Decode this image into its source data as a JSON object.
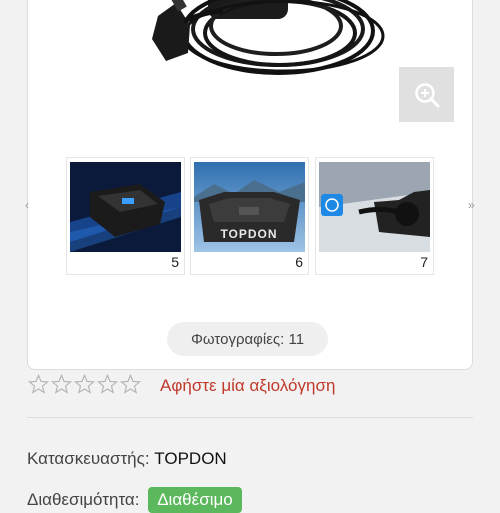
{
  "thumbnails": [
    {
      "number": "5"
    },
    {
      "number": "6",
      "brand": "TOPDON"
    },
    {
      "number": "7"
    }
  ],
  "photo_count": "Φωτογραφίες: 11",
  "rating": {
    "stars": 5,
    "filled": 0
  },
  "review_link": "Αφήστε μία αξιολόγηση",
  "manufacturer": {
    "label": "Κατασκευαστής:",
    "value": "TOPDON"
  },
  "availability": {
    "label": "Διαθεσιμότητα:",
    "value": "Διαθέσιμο"
  },
  "icons": {
    "zoom": "zoom-in-icon",
    "prev": "chevron-left-icon",
    "next": "chevron-right-icon",
    "star": "star-outline-icon"
  },
  "colors": {
    "review_link": "#c0392b",
    "availability_badge": "#5cb85c"
  }
}
